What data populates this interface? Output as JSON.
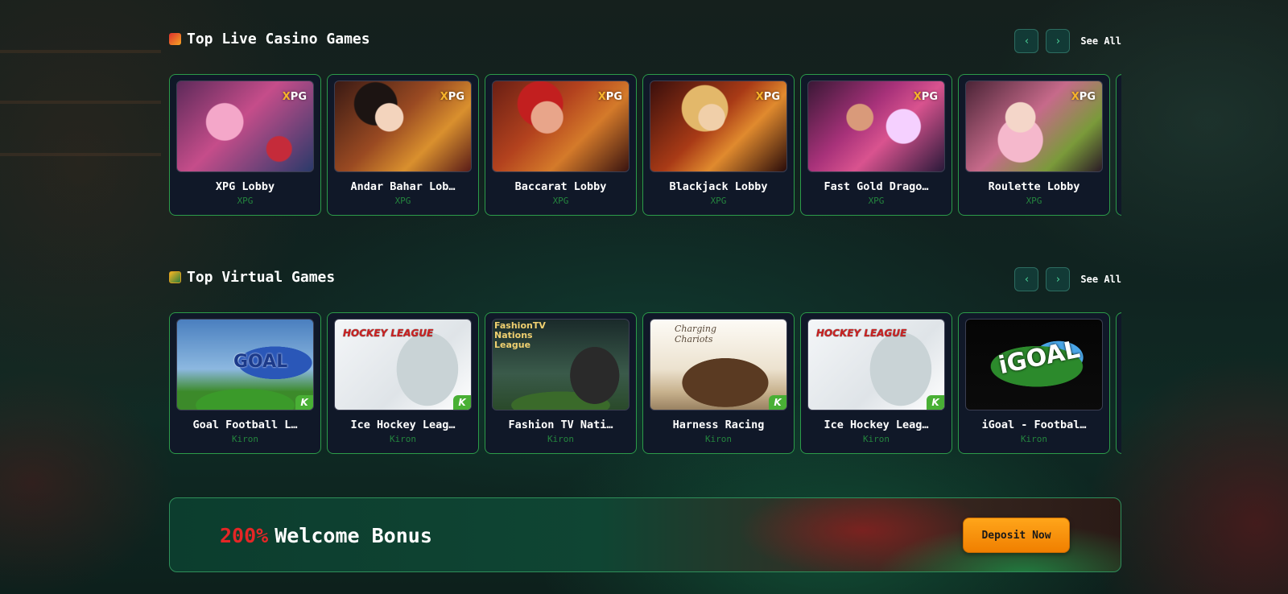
{
  "live_section": {
    "title": "Top Live Casino Games",
    "see_all": "See All",
    "prev_icon": "‹",
    "next_icon": "›",
    "games": [
      {
        "name": "XPG Lobby",
        "provider": "XPG"
      },
      {
        "name": "Andar Bahar Lob…",
        "provider": "XPG"
      },
      {
        "name": "Baccarat Lobby",
        "provider": "XPG"
      },
      {
        "name": "Blackjack Lobby",
        "provider": "XPG"
      },
      {
        "name": "Fast Gold Drago…",
        "provider": "XPG"
      },
      {
        "name": "Roulette Lobby",
        "provider": "XPG"
      }
    ]
  },
  "virtual_section": {
    "title": "Top Virtual Games",
    "see_all": "See All",
    "prev_icon": "‹",
    "next_icon": "›",
    "games": [
      {
        "name": "Goal Football L…",
        "provider": "Kiron"
      },
      {
        "name": "Ice Hockey Leag…",
        "provider": "Kiron"
      },
      {
        "name": "Fashion TV Nati…",
        "provider": "Kiron"
      },
      {
        "name": "Harness Racing",
        "provider": "Kiron"
      },
      {
        "name": "Ice Hockey Leag…",
        "provider": "Kiron"
      },
      {
        "name": "iGoal - Footbal…",
        "provider": "Kiron"
      }
    ]
  },
  "thumb_text": {
    "xpg_brand": "PG",
    "xpg_x": "X",
    "kiron_badge": "K",
    "goal": "GOAL",
    "hockey": "HOCKEY LEAGUE",
    "fashion_line1": "FashionTV",
    "fashion_line2": "Nations",
    "fashion_line3": "League",
    "chariots_line1": "Charging",
    "chariots_line2": "Chariots",
    "igoal": "iGOAL"
  },
  "banner": {
    "percent": "200%",
    "text": "Welcome Bonus",
    "button": "Deposit Now"
  },
  "colors": {
    "accent_green": "#2c9b49",
    "provider_green": "#24843e",
    "bonus_red": "#e52626",
    "deposit_orange": "#f59a12"
  }
}
